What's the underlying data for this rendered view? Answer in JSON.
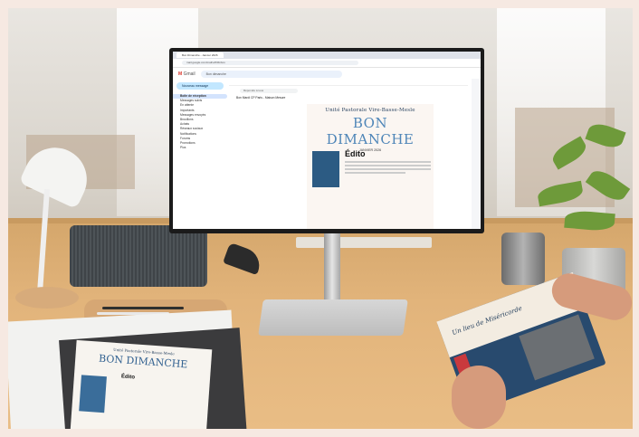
{
  "scene": {
    "description_tags": [
      "office-desk",
      "monitor",
      "newsletter"
    ]
  },
  "browser": {
    "tab_title": "Bon Dimanche - Janvier 2026",
    "url": "mail.google.com/mail/u/0/#inbox"
  },
  "gmail": {
    "logo": "Gmail",
    "search_placeholder": "Bon dimanche",
    "compose_label": "Nouveau message",
    "sidebar_items": [
      "Boîte de réception",
      "Messages suivis",
      "En attente",
      "Importants",
      "Messages envoyés",
      "Brouillons",
      "Achats",
      "Réseaux sociaux",
      "Notifications",
      "Forums",
      "Promotions",
      "Plus"
    ],
    "reply_label": "Répondre à tous",
    "message_from": "Bon Mardi CP Paris - Maison Mesure",
    "message_meta": "Bon dimanche"
  },
  "newsletter": {
    "subtitle": "Unité Pastorale Vire-Basse-Mesle",
    "title": "BON DIMANCHE",
    "date": "JANVIER 2026",
    "section": "Édito"
  },
  "print": {
    "title": "BON DIMANCHE",
    "subtitle": "Unité Pastorale Vire-Basse-Mesle",
    "section": "Édito"
  },
  "magazine": {
    "title": "Un lieu de Miséricorde"
  }
}
